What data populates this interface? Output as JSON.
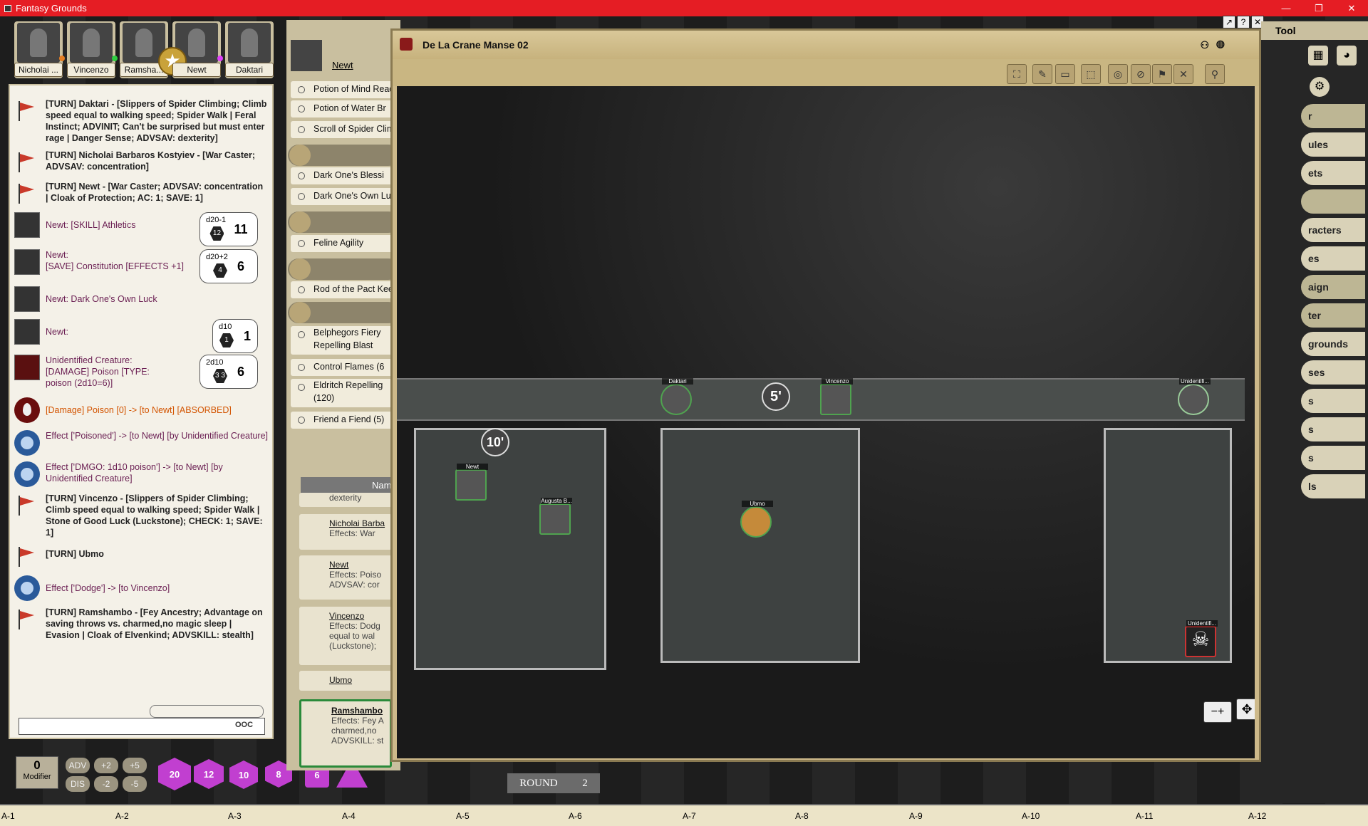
{
  "window": {
    "title": "Fantasy Grounds",
    "controls": [
      "—",
      "❐",
      "✕"
    ]
  },
  "party": [
    {
      "name": "Nicholai ...",
      "dot": "#e67e22"
    },
    {
      "name": "Vincenzo",
      "dot": "#2ecc40"
    },
    {
      "name": "Ramsha...",
      "dot": ""
    },
    {
      "name": "Newt",
      "dot": "#e040fb"
    },
    {
      "name": "Daktari",
      "dot": ""
    }
  ],
  "chat": {
    "entries": [
      {
        "kind": "turn",
        "text": "[TURN] Daktari - [Slippers of Spider Climbing; Climb speed equal to walking speed; Spider Walk | Feral Instinct; ADVINIT; Can't be surprised but must enter rage | Danger Sense; ADVSAV: dexterity]"
      },
      {
        "kind": "turn",
        "text": "[TURN] Nicholai Barbaros Kostyiev - [War Caster; ADVSAV: concentration]"
      },
      {
        "kind": "turn",
        "text": "[TURN] Newt - [War Caster; ADVSAV: concentration | Cloak of Protection; AC: 1; SAVE: 1]"
      },
      {
        "kind": "roll",
        "text": "Newt:    [SKILL] Athletics",
        "dice": "d20-1",
        "face": "12",
        "total": "11"
      },
      {
        "kind": "roll",
        "text": "Newt:\n[SAVE] Constitution [EFFECTS +1]",
        "dice": "d20+2",
        "face": "4",
        "total": "6"
      },
      {
        "kind": "roll",
        "text": "Newt:    Dark One's Own Luck",
        "dice": "",
        "face": "",
        "total": ""
      },
      {
        "kind": "roll",
        "text": "Newt:",
        "dice": "d10",
        "face": "1",
        "total": "1"
      },
      {
        "kind": "roll",
        "text": "Unidentified Creature: [DAMAGE] Poison [TYPE: poison (2d10=6)]",
        "dice": "2d10",
        "face": "3 3",
        "total": "6"
      },
      {
        "kind": "damage",
        "text": "[Damage] Poison [0] -> [to Newt] [ABSORBED]"
      },
      {
        "kind": "effect",
        "text": "Effect ['Poisoned'] -> [to Newt] [by Unidentified Creature]"
      },
      {
        "kind": "effect",
        "text": "Effect ['DMGO: 1d10 poison'] -> [to Newt] [by Unidentified Creature]"
      },
      {
        "kind": "turn",
        "text": "[TURN] Vincenzo - [Slippers of Spider Climbing; Climb speed equal to walking speed; Spider Walk | Stone of Good Luck (Luckstone); CHECK: 1; SAVE: 1]"
      },
      {
        "kind": "turn",
        "text": "[TURN] Ubmo"
      },
      {
        "kind": "effect",
        "text": "Effect ['Dodge'] -> [to Vincenzo]"
      },
      {
        "kind": "turn",
        "text": "[TURN] Ramshambo - [Fey Ancestry; Advantage on saving throws vs. charmed,no magic sleep | Evasion | Cloak of Elvenkind; ADVSKILL: stealth]"
      }
    ],
    "ooc": "OOC"
  },
  "modifier": {
    "value": "0",
    "label": "Modifier",
    "buttons": [
      "ADV",
      "+2",
      "+5",
      "DIS",
      "-2",
      "-5"
    ]
  },
  "dice": [
    "20",
    "12",
    "10",
    "8",
    "6"
  ],
  "sheet": {
    "name": "Newt",
    "items": [
      "Potion of Mind Read",
      "Potion of Water Br",
      "Scroll of Spider Clim",
      "Dark One's Blessi",
      "Dark One's Own Luc",
      "Feline Agility",
      "Rod of the Pact Keep",
      "Belphegors Fiery Repelling Blast",
      "Control Flames (6",
      "Eldritch Repelling (120)",
      "Friend a Fiend (5)"
    ]
  },
  "ct": {
    "header": "Nam",
    "rows": [
      {
        "name": "",
        "fx": "dexterity"
      },
      {
        "name": "Nicholai Barba",
        "fx": "Effects: War"
      },
      {
        "name": "Newt",
        "fx": "Effects: Poiso ADVSAV: cor"
      },
      {
        "name": "Vincenzo",
        "fx": "Effects: Dodg equal to wal (Luckstone);"
      },
      {
        "name": "Ubmo",
        "fx": ""
      },
      {
        "name": "Ramshambo",
        "fx": "Effects: Fey A charmed,no ADVSKILL: st"
      }
    ],
    "round_label": "ROUND",
    "round": "2"
  },
  "map": {
    "title": "De La Crane Manse 02",
    "measures": [
      "5'",
      "10'"
    ],
    "tokens": [
      "Daktari",
      "Vincenzo",
      "Unidentifi...",
      "Newt",
      "Augusta B...",
      "Ubmo",
      "Unidentifi..."
    ]
  },
  "sidebar": {
    "title": "Tool",
    "items": [
      "r",
      "ules",
      "ets",
      "",
      "racters",
      "es",
      "aign",
      "ter",
      "grounds",
      "ses",
      "s",
      "s",
      "s",
      "ls"
    ]
  },
  "ruler": [
    "A-1",
    "A-2",
    "A-3",
    "A-4",
    "A-5",
    "A-6",
    "A-7",
    "A-8",
    "A-9",
    "A-10",
    "A-11",
    "A-12"
  ]
}
